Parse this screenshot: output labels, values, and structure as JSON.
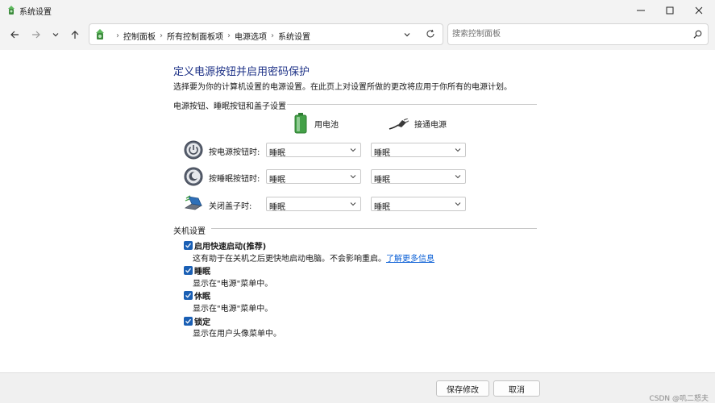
{
  "window": {
    "title": "系统设置",
    "controls": [
      "minimize-icon",
      "maximize-icon",
      "close-icon"
    ]
  },
  "nav": {
    "buttons": [
      "back-arrow-icon",
      "forward-arrow-icon",
      "chevron-down-icon",
      "up-arrow-icon"
    ],
    "breadcrumb": [
      "控制面板",
      "所有控制面板项",
      "电源选项",
      "系统设置"
    ],
    "search_placeholder": "搜索控制面板"
  },
  "main": {
    "title": "定义电源按钮并启用密码保护",
    "description": "选择要为你的计算机设置的电源设置。在此页上对设置所做的更改将应用于你所有的电源计划。",
    "buttons_section": {
      "heading": "电源按钮、睡眠按钮和盖子设置",
      "columns": [
        "用电池",
        "接通电源"
      ],
      "rows": [
        {
          "label": "按电源按钮时:",
          "battery": "睡眠",
          "plugged": "睡眠",
          "icon": "power-button-icon"
        },
        {
          "label": "按睡眠按钮时:",
          "battery": "睡眠",
          "plugged": "睡眠",
          "icon": "sleep-button-icon"
        },
        {
          "label": "关闭盖子时:",
          "battery": "睡眠",
          "plugged": "睡眠",
          "icon": "laptop-lid-icon"
        }
      ]
    },
    "shutdown_section": {
      "heading": "关机设置",
      "items": [
        {
          "label": "启用快速启动(推荐)",
          "desc": "这有助于在关机之后更快地启动电脑。不会影响重启。",
          "link": "了解更多信息",
          "checked": true
        },
        {
          "label": "睡眠",
          "desc": "显示在\"电源\"菜单中。",
          "checked": true
        },
        {
          "label": "休眠",
          "desc": "显示在\"电源\"菜单中。",
          "checked": true
        },
        {
          "label": "锁定",
          "desc": "显示在用户头像菜单中。",
          "checked": true
        }
      ]
    }
  },
  "footer": {
    "save_label": "保存修改",
    "cancel_label": "取消",
    "watermark": "CSDN @叽二怒夫"
  }
}
